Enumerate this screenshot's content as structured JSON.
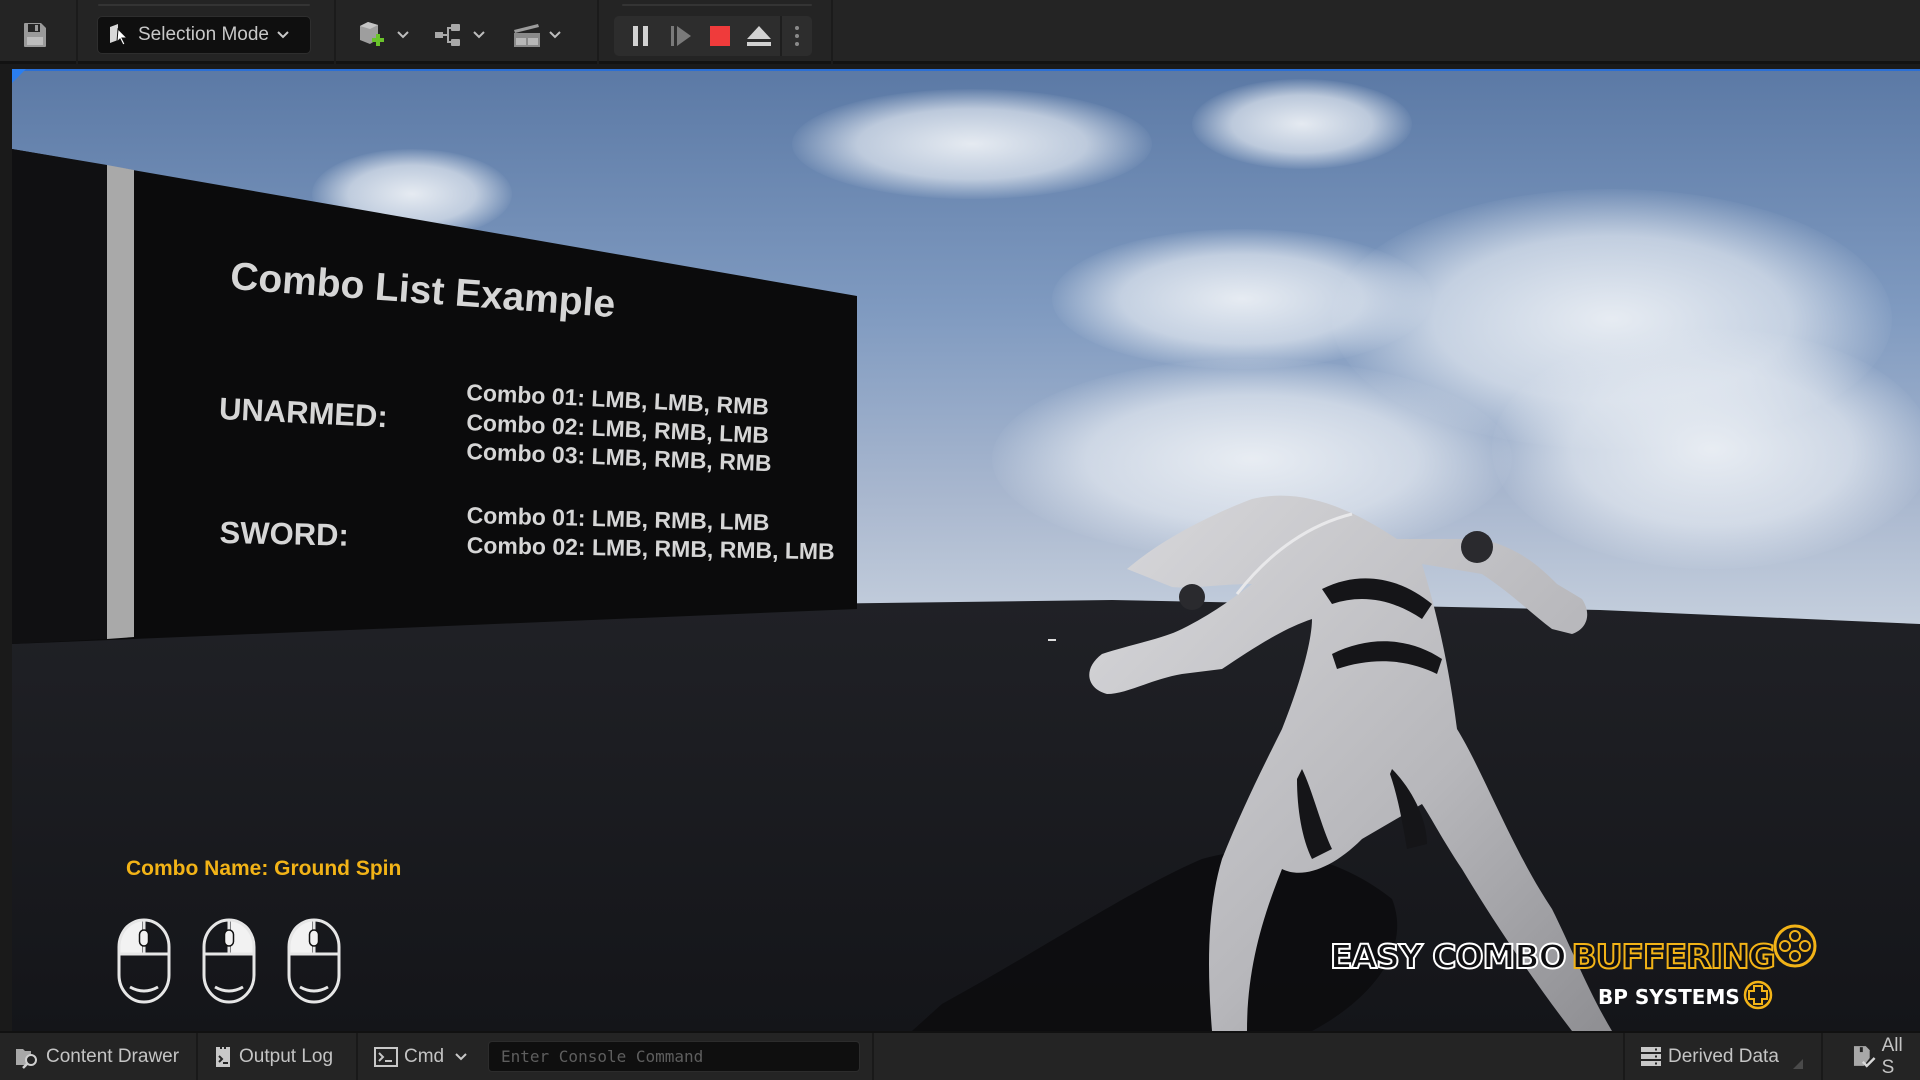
{
  "toolbar": {
    "save_icon": "save-icon",
    "mode_selector": {
      "label": "Selection Mode",
      "icon": "selection-cursor-icon"
    },
    "dropdowns": [
      {
        "name": "add-actor",
        "icon": "add-actor-icon"
      },
      {
        "name": "blueprints",
        "icon": "blueprint-hierarchy-icon"
      },
      {
        "name": "cinematics",
        "icon": "clapperboard-icon"
      }
    ],
    "play_controls": [
      {
        "name": "pause",
        "icon": "pause-icon"
      },
      {
        "name": "frame-skip",
        "icon": "step-forward-icon"
      },
      {
        "name": "stop",
        "icon": "stop-icon",
        "color": "#ef3b3b"
      },
      {
        "name": "eject",
        "icon": "eject-icon"
      },
      {
        "name": "more-options",
        "icon": "vertical-dots-icon"
      }
    ]
  },
  "viewport": {
    "wall": {
      "title": "Combo List Example",
      "categories": [
        {
          "name": "UNARMED:",
          "combos": [
            "Combo 01: LMB, LMB, RMB",
            "Combo 02: LMB, RMB, LMB",
            "Combo 03: LMB, RMB, RMB"
          ]
        },
        {
          "name": "SWORD:",
          "combos": [
            "Combo 01: LMB, RMB, LMB",
            "Combo 02: LMB, RMB, RMB, LMB"
          ]
        }
      ]
    },
    "hud": {
      "combo_name": "Combo Name: Ground Spin",
      "combo_name_color": "#f2b317",
      "input_sequence": [
        "LMB",
        "RMB",
        "LMB"
      ]
    },
    "logo": {
      "word_white": "EASY COMBO",
      "word_yellow": "BUFFERING",
      "subtitle": "BP SYSTEMS",
      "accent": "#f2b317"
    },
    "accent_border": "#2a6fd6"
  },
  "statusbar": {
    "content_drawer": "Content Drawer",
    "output_log": "Output Log",
    "cmd": "Cmd",
    "console_placeholder": "Enter Console Command",
    "console_value": "",
    "derived_data": "Derived Data",
    "all_saved": "All S"
  }
}
